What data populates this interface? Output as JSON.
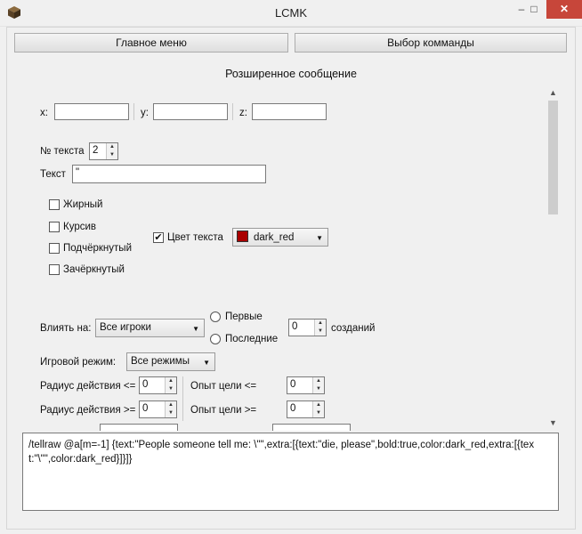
{
  "window": {
    "title": "LCMK",
    "minimize_glyph": "–",
    "maximize_glyph": "□",
    "close_glyph": "✕",
    "icon": "minecraft-block-icon"
  },
  "toolbar": {
    "main_menu_label": "Главное меню",
    "command_select_label": "Выбор комманды"
  },
  "page": {
    "heading": "Розширенное сообщение"
  },
  "coords": {
    "x_label": "x:",
    "y_label": "y:",
    "z_label": "z:",
    "x_value": "",
    "y_value": "",
    "z_value": ""
  },
  "text_block": {
    "number_label": "№ текста",
    "number_value": "2",
    "text_label": "Текст",
    "text_value": "\""
  },
  "formatting": {
    "bold_label": "Жирный",
    "italic_label": "Курсив",
    "underline_label": "Подчёркнутый",
    "strike_label": "Зачёркнутый",
    "color_label": "Цвет текста",
    "color_checked": "✔",
    "color_value": "dark_red",
    "color_swatch": "#aa0000"
  },
  "targeting": {
    "affect_label": "Влиять на:",
    "affect_value": "Все игроки",
    "first_label": "Первые",
    "last_label": "Последние",
    "count_value": "0",
    "created_label": "созданий",
    "gamemode_label": "Игровой режим:",
    "gamemode_value": "Все режимы",
    "radius_max_label": "Радиус действия <=",
    "radius_max_value": "0",
    "radius_min_label": "Радиус действия >=",
    "radius_min_value": "0",
    "xp_max_label": "Опыт цели <=",
    "xp_max_value": "0",
    "xp_min_label": "Опыт цели >=",
    "xp_min_value": "0"
  },
  "output": {
    "command": "/tellraw @a[m=-1] {text:\"People someone tell me: \\\"\",extra:[{text:\"die, please\",bold:true,color:dark_red,extra:[{text:\"\\\"\",color:dark_red}]}]}"
  }
}
